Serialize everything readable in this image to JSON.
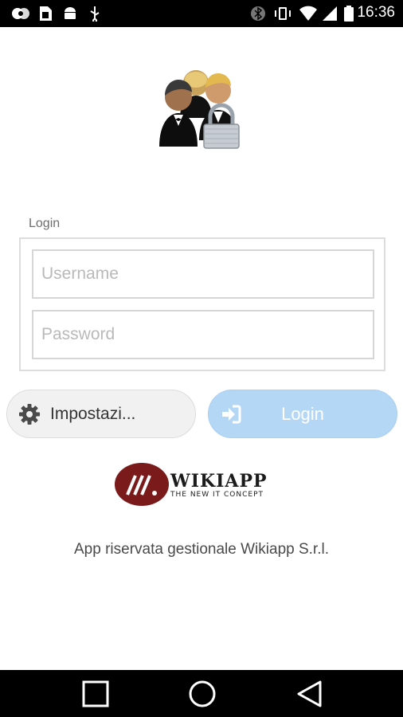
{
  "status_bar": {
    "time": "16:36",
    "icons": [
      "circles-icon",
      "sim-card-icon",
      "android-icon",
      "usb-icon",
      "bluetooth-icon",
      "vibrate-icon",
      "wifi-icon",
      "signal-icon",
      "battery-icon"
    ]
  },
  "login_form": {
    "legend": "Login",
    "username_placeholder": "Username",
    "password_placeholder": "Password"
  },
  "buttons": {
    "settings_label": "Impostazi...",
    "login_label": "Login"
  },
  "logo": {
    "brand": "WIKIAPP",
    "tagline": "THE NEW IT CONCEPT",
    "color": "#7a1a1a"
  },
  "footer_note": "App riservata gestionale Wikiapp S.r.l.",
  "nav_bar": {
    "icons": [
      "recents-icon",
      "home-icon",
      "back-icon"
    ]
  },
  "colors": {
    "login_button": "#b4d7f6",
    "settings_button": "#f1f1f1"
  }
}
